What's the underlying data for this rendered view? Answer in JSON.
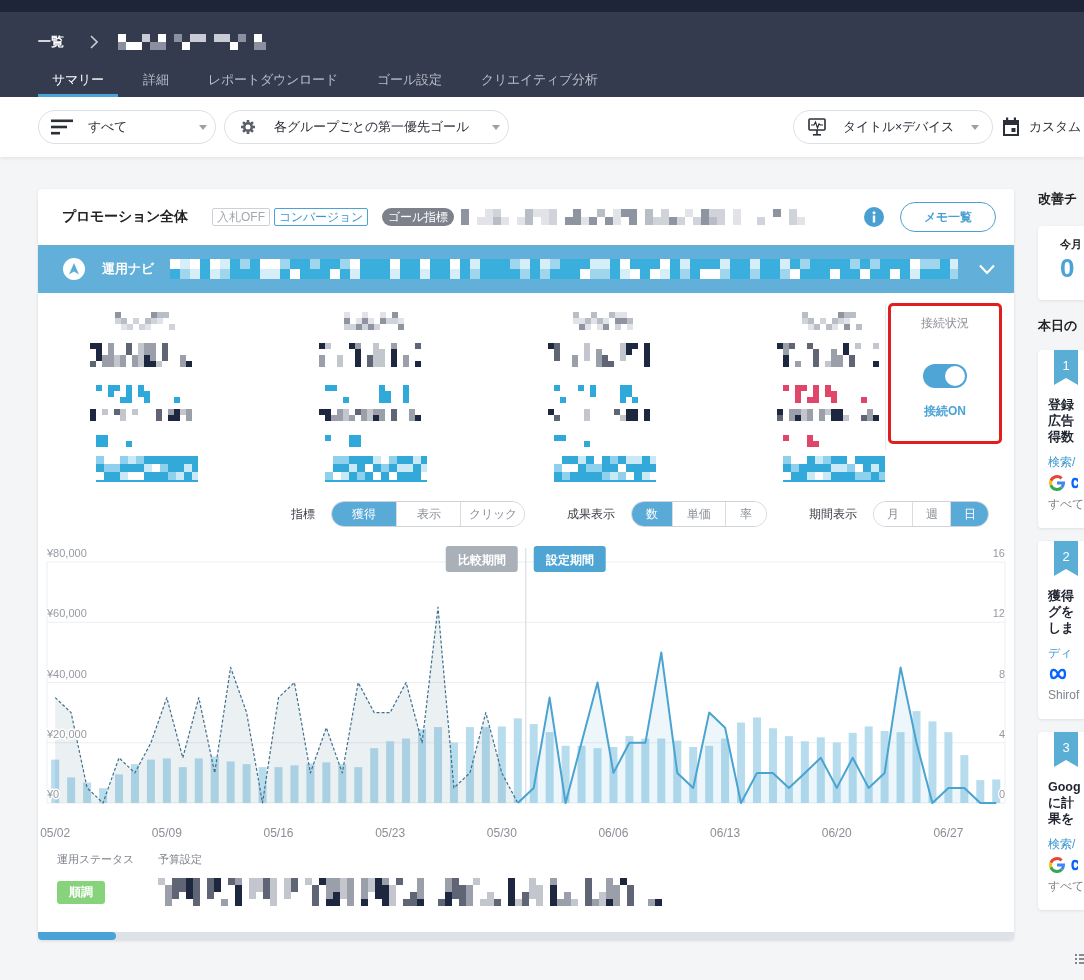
{
  "header": {
    "breadcrumb": [
      {
        "label": "一覧"
      }
    ],
    "current_page": {
      "redacted": true
    },
    "tabs": [
      {
        "label": "サマリー",
        "selected": true
      },
      {
        "label": "詳細",
        "selected": false
      },
      {
        "label": "レポートダウンロード",
        "selected": false
      },
      {
        "label": "ゴール設定",
        "selected": false
      },
      {
        "label": "クリエイティブ分析",
        "selected": false
      }
    ]
  },
  "toolbar": {
    "left_selects": [
      {
        "kind": "filter",
        "value": "すべて"
      },
      {
        "kind": "settings",
        "value": "各グループごとの第一優先ゴール"
      }
    ],
    "right_select": {
      "kind": "display",
      "value": "タイトル×デバイス"
    },
    "date_range": {
      "label": "カスタム"
    }
  },
  "summary": {
    "title": "プロモーション全体",
    "tags": [
      {
        "label": "入札OFF",
        "disabled": true
      },
      {
        "label": "コンバージョン",
        "disabled": false
      }
    ],
    "goal": {
      "label": "ゴール指標",
      "redacted": true
    },
    "memo_button": {
      "label": "メモ一覧"
    },
    "navi": {
      "label": "運用ナビ",
      "redacted": true,
      "expanded": false
    },
    "metrics": [
      {
        "redacted": true,
        "color": "#2fa8da"
      },
      {
        "redacted": true,
        "color": "#2fa8da"
      },
      {
        "redacted": true,
        "color": "#2fa8da"
      },
      {
        "redacted": true,
        "color": "#e0456a"
      }
    ],
    "connection": {
      "label": "接続状況",
      "on": true,
      "status": "接続ON",
      "highlighted": true
    },
    "controls": [
      {
        "label": "指標",
        "options": [
          {
            "label": "獲得",
            "selected": true
          },
          {
            "label": "表示",
            "selected": false
          },
          {
            "label": "クリック",
            "selected": false
          }
        ]
      },
      {
        "label": "成果表示",
        "options": [
          {
            "label": "数",
            "selected": true
          },
          {
            "label": "単価",
            "selected": false
          },
          {
            "label": "率",
            "selected": false
          }
        ]
      },
      {
        "label": "期間表示",
        "options": [
          {
            "label": "月",
            "selected": false
          },
          {
            "label": "週",
            "selected": false
          },
          {
            "label": "日",
            "selected": true
          }
        ]
      }
    ],
    "chart_data": {
      "type": "bar",
      "grid": true,
      "categories": [
        "05/02",
        null,
        null,
        null,
        null,
        null,
        null,
        "05/09",
        null,
        null,
        null,
        null,
        null,
        null,
        "05/16",
        null,
        null,
        null,
        null,
        null,
        null,
        "05/23",
        null,
        null,
        null,
        null,
        null,
        null,
        "05/30",
        null,
        null,
        null,
        null,
        null,
        null,
        "06/06",
        null,
        null,
        null,
        null,
        null,
        null,
        "06/13",
        null,
        null,
        null,
        null,
        null,
        null,
        "06/20",
        null,
        null,
        null,
        null,
        null,
        null,
        "06/27",
        null,
        null,
        null
      ],
      "ylim": [
        0,
        80000
      ],
      "yticks": [
        {
          "value": 0,
          "label": "¥0"
        },
        {
          "value": 20000,
          "label": "¥20,000"
        },
        {
          "value": 40000,
          "label": "¥40,000"
        },
        {
          "value": 60000,
          "label": "¥60,000"
        },
        {
          "value": 80000,
          "label": "¥80,000"
        }
      ],
      "y2lim": [
        0,
        16
      ],
      "y2ticks": [
        0,
        4,
        8,
        12,
        16
      ],
      "series": [
        {
          "color": "#b7dcee",
          "values": [
            14400,
            8500,
            6800,
            4900,
            9500,
            12900,
            14400,
            14800,
            11900,
            14800,
            15400,
            13800,
            12900,
            11900,
            11900,
            12500,
            13100,
            13500,
            12900,
            11900,
            18200,
            20500,
            21400,
            24500,
            25200,
            20100,
            25200,
            25200,
            25400,
            28100,
            26200,
            23500,
            19000,
            19000,
            18200,
            18600,
            22200,
            21400,
            21400,
            20700,
            18600,
            19000,
            21400,
            26700,
            28400,
            24800,
            22200,
            20500,
            21800,
            20100,
            23300,
            25400,
            23900,
            23500,
            30500,
            27100,
            23500,
            15900,
            7600,
            7800
          ]
        },
        {
          "type": "area",
          "axis": "y2",
          "line_style": "dashed",
          "color": "#3f6f8c",
          "values": [
            7,
            6,
            1,
            0,
            3,
            2,
            4,
            7,
            3,
            7,
            2,
            9,
            6,
            0,
            7,
            8,
            2,
            5,
            2,
            8,
            6,
            6,
            8,
            4,
            13,
            1,
            2,
            6,
            2,
            0,
            null,
            null,
            null,
            null,
            null,
            null,
            null,
            null,
            null,
            null,
            null,
            null,
            null,
            null,
            null,
            null,
            null,
            null,
            null,
            null,
            null,
            null,
            null,
            null,
            null,
            null,
            null,
            null,
            null,
            null
          ]
        },
        {
          "type": "area",
          "axis": "y2",
          "line_style": "solid",
          "color": "#4aa3d0",
          "values": [
            null,
            null,
            null,
            null,
            null,
            null,
            null,
            null,
            null,
            null,
            null,
            null,
            null,
            null,
            null,
            null,
            null,
            null,
            null,
            null,
            null,
            null,
            null,
            null,
            null,
            null,
            null,
            null,
            null,
            0,
            1,
            7,
            0,
            4,
            8,
            2,
            4,
            4,
            10,
            2,
            1,
            6,
            5,
            0,
            2,
            2,
            1,
            2,
            3,
            1,
            3,
            1,
            2,
            9,
            4,
            0,
            1,
            1,
            0,
            0
          ]
        }
      ],
      "annotations": [
        "比較期間",
        "設定期間"
      ]
    },
    "status": {
      "label": "運用ステータス",
      "value": "順調"
    },
    "budget": {
      "label": "予算設定",
      "redacted": true
    }
  },
  "sidebar": {
    "title": "改善チ",
    "month": {
      "label": "今月",
      "count": "0"
    },
    "today_title": "本日の",
    "tasks": [
      {
        "rank": "1",
        "title": "登録広告得数",
        "category": "検索/",
        "platforms": [
          {
            "kind": "google"
          },
          {
            "kind": "meta_cut"
          }
        ],
        "scope": "すべて"
      },
      {
        "rank": "2",
        "title": "獲得グをしま",
        "category": "ディ",
        "platforms": [
          {
            "kind": "meta"
          }
        ],
        "scope": "Shirof"
      },
      {
        "rank": "3",
        "title": "Googに計果を",
        "category": "検索/",
        "platforms": [
          {
            "kind": "google"
          },
          {
            "kind": "meta_cut"
          }
        ],
        "scope": "すべて"
      }
    ]
  }
}
